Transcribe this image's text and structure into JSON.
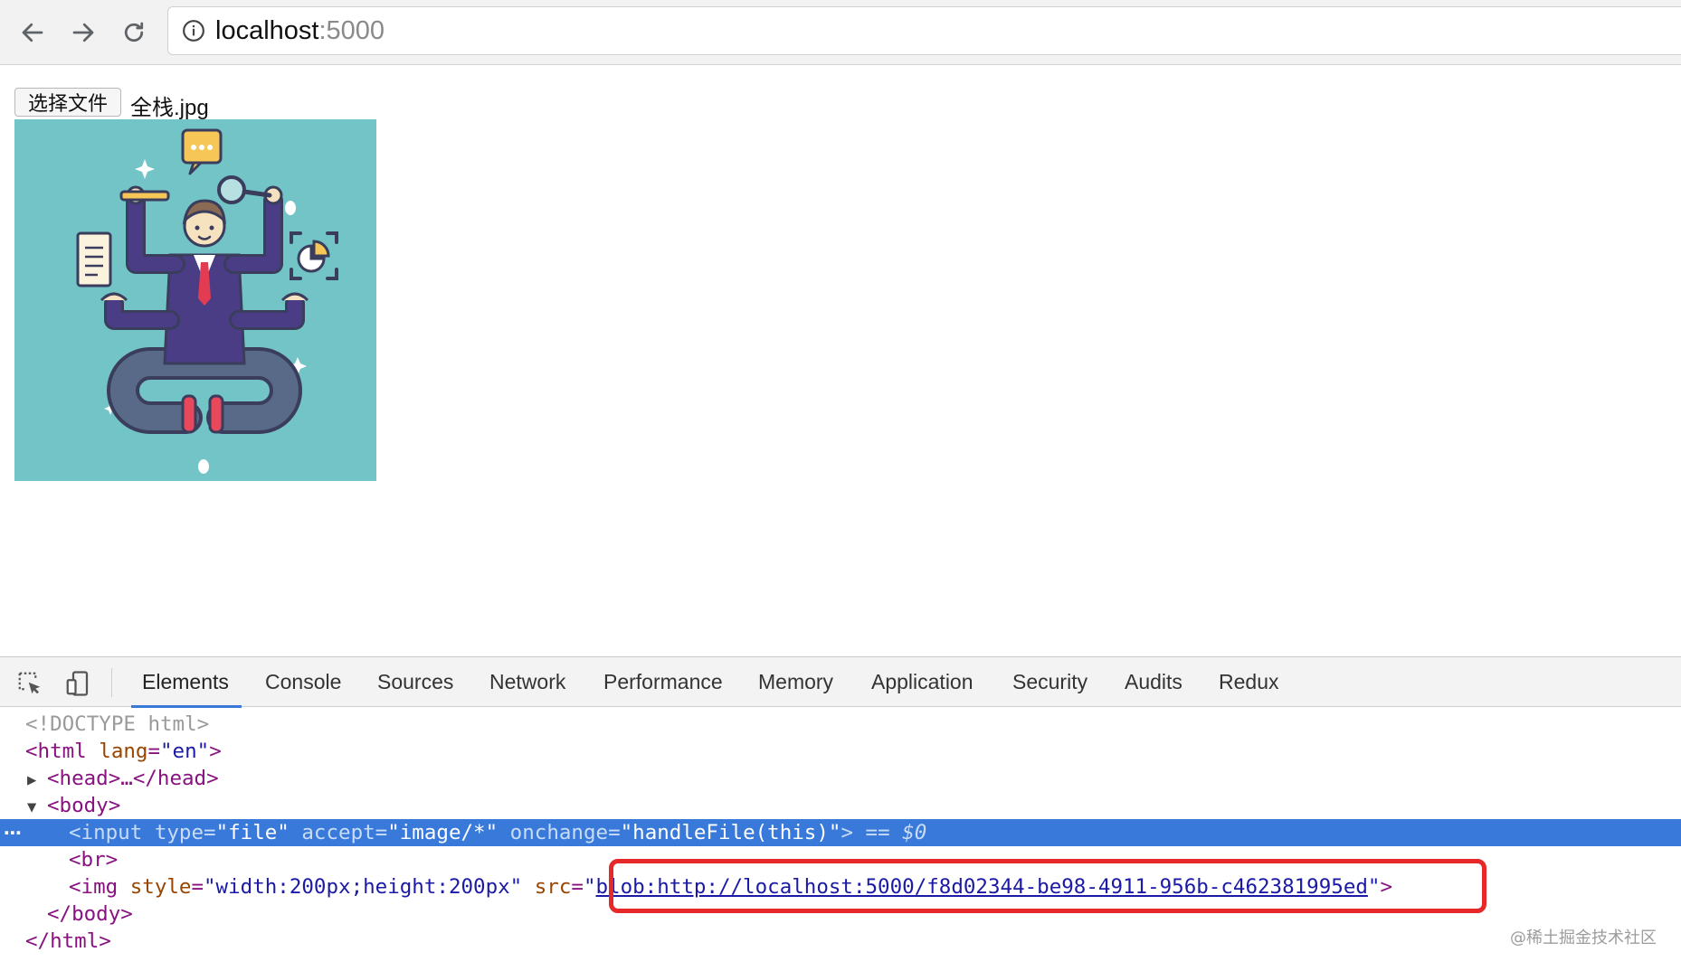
{
  "browser": {
    "url_host": "localhost",
    "url_port": ":5000",
    "icons": {
      "back": "arrow-left-icon",
      "forward": "arrow-right-icon",
      "reload": "reload-icon",
      "site_info": "info-icon"
    }
  },
  "page": {
    "file_button_label": "选择文件",
    "file_name": "全栈.jpg",
    "preview_image": "illustration of a multi-armed office worker holding a pencil, magnifier, document and chart on teal background"
  },
  "devtools": {
    "tabs": [
      "Elements",
      "Console",
      "Sources",
      "Network",
      "Performance",
      "Memory",
      "Application",
      "Security",
      "Audits",
      "Redux"
    ],
    "active_tab": "Elements",
    "dom": {
      "doctype": "<!DOCTYPE html>",
      "html_open_tag": "<html",
      "html_attr_name": " lang",
      "html_attr_value": "\"en\"",
      "head_collapsed": "<head>…</head>",
      "body_open": "<body>",
      "input_line": {
        "tag": "<input",
        "attr1": " type",
        "val1": "\"file\"",
        "attr2": " accept",
        "val2": "\"image/*\"",
        "attr3": " onchange",
        "val3": "\"handleFile(this)\"",
        "close": ">",
        "eq": " == ",
        "dollar": "$0"
      },
      "br_tag": "<br>",
      "img_line": {
        "tag": "<img",
        "attr1": " style",
        "val1": "\"width:200px;height:200px\"",
        "attr2": " src",
        "src_value": "blob:http://localhost:5000/f8d02344-be98-4911-956b-c462381995ed"
      },
      "body_close": "</body>",
      "html_close": "</html>"
    }
  },
  "watermark": "@稀土掘金技术社区",
  "colors": {
    "selection": "#3879d9",
    "highlight_box": "#e62828",
    "preview_bg": "#72c4c6"
  }
}
